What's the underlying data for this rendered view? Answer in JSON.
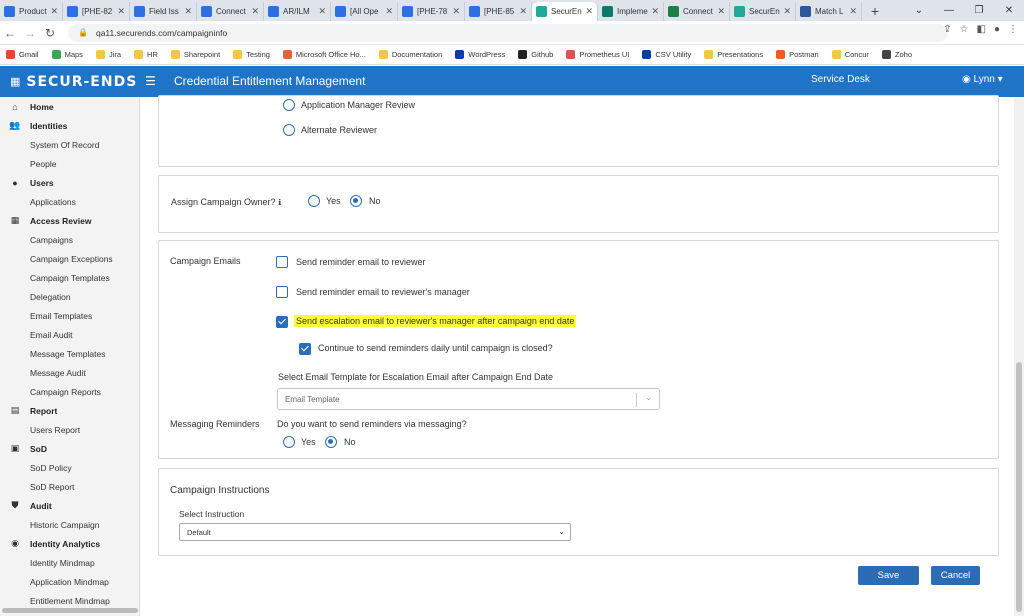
{
  "browser": {
    "tabs": [
      {
        "label": "Product",
        "color": "#2f6fe4"
      },
      {
        "label": "[PHE-82",
        "color": "#2f6fe4"
      },
      {
        "label": "Field Iss",
        "color": "#2f6fe4"
      },
      {
        "label": "Connect",
        "color": "#2f6fe4"
      },
      {
        "label": "AR/ILM",
        "color": "#2f6fe4"
      },
      {
        "label": "[All Ope",
        "color": "#2f6fe4"
      },
      {
        "label": "[PHE-78",
        "color": "#2f6fe4"
      },
      {
        "label": "[PHE-85",
        "color": "#2f6fe4"
      },
      {
        "label": "SecurEn",
        "color": "#20a89a"
      },
      {
        "label": "Impleme",
        "color": "#0b7a66"
      },
      {
        "label": "Connect",
        "color": "#1e7e45"
      },
      {
        "label": "SecurEn",
        "color": "#20a89a"
      },
      {
        "label": "Match L",
        "color": "#2b579a"
      }
    ],
    "active_tab_index": 8,
    "url": "qa11.securends.com/campaigninfo",
    "bookmarks": [
      {
        "label": "Gmail",
        "color": "#ea4335"
      },
      {
        "label": "Maps",
        "color": "#34a853"
      },
      {
        "label": "Jira",
        "color": "#f2c744"
      },
      {
        "label": "HR",
        "color": "#f2c744"
      },
      {
        "label": "Sharepoint",
        "color": "#f2c744"
      },
      {
        "label": "Testing",
        "color": "#f2c744"
      },
      {
        "label": "Microsoft Office Ho...",
        "color": "#e8603c"
      },
      {
        "label": "Documentation",
        "color": "#f2c744"
      },
      {
        "label": "WordPress",
        "color": "#0b3ea5"
      },
      {
        "label": "Github",
        "color": "#222222"
      },
      {
        "label": "Prometheus UI",
        "color": "#d9534f"
      },
      {
        "label": "CSV Utility",
        "color": "#0b3ea5"
      },
      {
        "label": "Presentations",
        "color": "#f2c744"
      },
      {
        "label": "Postman",
        "color": "#ef5b25"
      },
      {
        "label": "Concur",
        "color": "#f2c744"
      },
      {
        "label": "Zoho",
        "color": "#444444"
      }
    ]
  },
  "header": {
    "logo": "SECUR-ENDS",
    "title": "Credential Entitlement Management",
    "service_desk": "Service Desk",
    "user": "Lynn",
    "bg_color": "#1f74c7"
  },
  "sidebar": {
    "items": [
      {
        "label": "Home",
        "type": "section",
        "icon": "home-icon",
        "glyph": "⌂"
      },
      {
        "label": "Identities",
        "type": "section",
        "icon": "users-icon",
        "glyph": "👥"
      },
      {
        "label": "System Of Record",
        "type": "sub"
      },
      {
        "label": "People",
        "type": "sub"
      },
      {
        "label": "Users",
        "type": "section",
        "icon": "user-icon",
        "glyph": "●"
      },
      {
        "label": "Applications",
        "type": "sub"
      },
      {
        "label": "Access Review",
        "type": "section",
        "icon": "grid-icon",
        "glyph": "▦"
      },
      {
        "label": "Campaigns",
        "type": "sub"
      },
      {
        "label": "Campaign Exceptions",
        "type": "sub"
      },
      {
        "label": "Campaign Templates",
        "type": "sub"
      },
      {
        "label": "Delegation",
        "type": "sub"
      },
      {
        "label": "Email Templates",
        "type": "sub"
      },
      {
        "label": "Email Audit",
        "type": "sub"
      },
      {
        "label": "Message Templates",
        "type": "sub"
      },
      {
        "label": "Message Audit",
        "type": "sub"
      },
      {
        "label": "Campaign Reports",
        "type": "sub"
      },
      {
        "label": "Report",
        "type": "section",
        "icon": "report-icon",
        "glyph": "▤"
      },
      {
        "label": "Users Report",
        "type": "sub"
      },
      {
        "label": "SoD",
        "type": "section",
        "icon": "sod-icon",
        "glyph": "▣"
      },
      {
        "label": "SoD Policy",
        "type": "sub"
      },
      {
        "label": "SoD Report",
        "type": "sub"
      },
      {
        "label": "Audit",
        "type": "section",
        "icon": "shield-icon",
        "glyph": "⛊"
      },
      {
        "label": "Historic Campaign",
        "type": "sub"
      },
      {
        "label": "Identity Analytics",
        "type": "section",
        "icon": "analytics-icon",
        "glyph": "◉"
      },
      {
        "label": "Identity Mindmap",
        "type": "sub"
      },
      {
        "label": "Application Mindmap",
        "type": "sub"
      },
      {
        "label": "Entitlement Mindmap",
        "type": "sub"
      }
    ]
  },
  "reviewers": {
    "option_app_manager": "Application Manager Review",
    "option_alternate": "Alternate Reviewer"
  },
  "owner": {
    "label": "Assign Campaign Owner?",
    "yes": "Yes",
    "no": "No",
    "selected": "No"
  },
  "emails": {
    "section_label": "Campaign Emails",
    "reminder_reviewer": "Send reminder email to reviewer",
    "reminder_manager": "Send reminder email to reviewer's manager",
    "escalation": "Send escalation email to reviewer's manager after campaign end date",
    "continue_daily": "Continue to send reminders daily until campaign is closed?",
    "template_label": "Select Email Template for Escalation Email after Campaign End Date",
    "template_placeholder": "Email Template",
    "checked": {
      "reminder_reviewer": false,
      "reminder_manager": false,
      "escalation": true,
      "continue_daily": true
    }
  },
  "messaging": {
    "section_label": "Messaging Reminders",
    "question": "Do you want to send reminders via messaging?",
    "yes": "Yes",
    "no": "No",
    "selected": "No"
  },
  "instructions": {
    "title": "Campaign Instructions",
    "select_label": "Select Instruction",
    "selected_value": "Default"
  },
  "actions": {
    "save": "Save",
    "cancel": "Cancel"
  }
}
